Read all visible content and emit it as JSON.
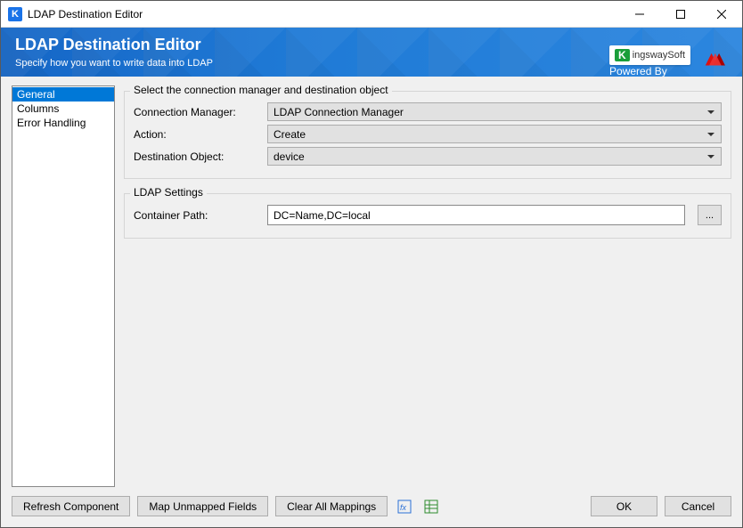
{
  "window": {
    "title": "LDAP Destination Editor",
    "app_icon_letter": "K"
  },
  "banner": {
    "title": "LDAP Destination Editor",
    "subtitle": "Specify how you want to write data into LDAP",
    "powered_by": "Powered By",
    "brand_k": "K",
    "brand_rest": "ingswaySoft"
  },
  "sidebar": {
    "items": [
      {
        "label": "General",
        "selected": true
      },
      {
        "label": "Columns",
        "selected": false
      },
      {
        "label": "Error Handling",
        "selected": false
      }
    ]
  },
  "group_connection": {
    "legend": "Select the connection manager and destination object",
    "rows": {
      "connection_manager": {
        "label": "Connection Manager:",
        "value": "LDAP Connection Manager"
      },
      "action": {
        "label": "Action:",
        "value": "Create"
      },
      "destination_object": {
        "label": "Destination Object:",
        "value": "device"
      }
    }
  },
  "group_ldap": {
    "legend": "LDAP Settings",
    "container_path": {
      "label": "Container Path:",
      "value": "DC=Name,DC=local",
      "browse": "..."
    }
  },
  "footer": {
    "refresh": "Refresh Component",
    "map_unmapped": "Map Unmapped Fields",
    "clear_all": "Clear All Mappings",
    "ok": "OK",
    "cancel": "Cancel"
  }
}
